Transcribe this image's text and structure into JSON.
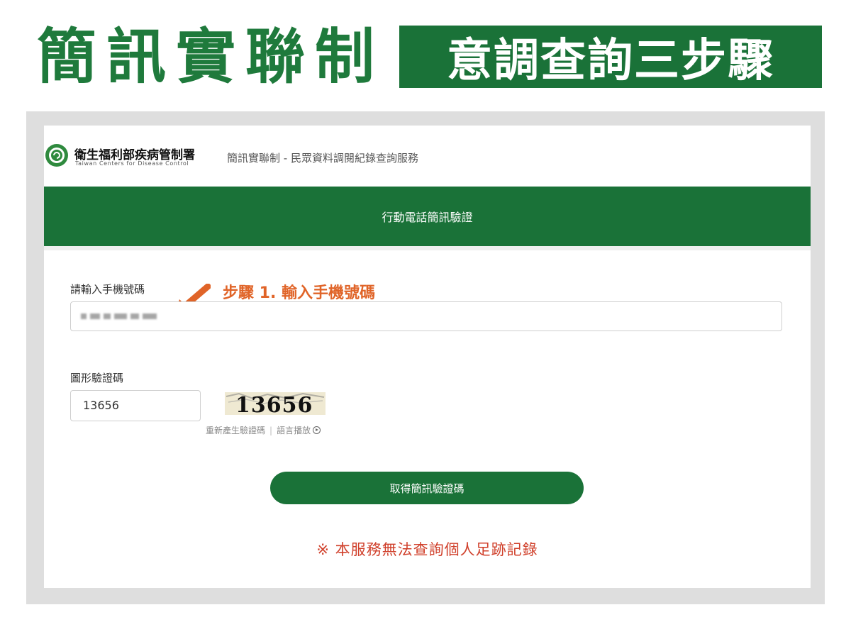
{
  "banner": {
    "title": "簡訊實聯制",
    "subtitle": "意調查詢三步驟"
  },
  "header": {
    "org_name_zh": "衛生福利部疾病管制署",
    "org_name_en": "Taiwan Centers for Disease Control",
    "service_title": "簡訊實聯制 - 民眾資料調閱紀錄查詢服務",
    "logo_icon": "cdc-logo-icon"
  },
  "green_bar": {
    "title": "行動電話簡訊驗證"
  },
  "form": {
    "phone_label": "請輸入手機號碼",
    "phone_value": "",
    "step_note": "步驟 1. 輸入手機號碼",
    "captcha_label": "圖形驗證碼",
    "captcha_value": "13656",
    "captcha_image_text": "13656",
    "regenerate_link": "重新產生驗證碼",
    "audio_link": "語言播放",
    "submit_button": "取得簡訊驗證碼"
  },
  "notice": "※ 本服務無法查詢個人足跡記錄",
  "colors": {
    "brand_green": "#1a7238",
    "banner_green": "#1f7a3c",
    "step_orange": "#e06428",
    "notice_red": "#d0402b"
  }
}
